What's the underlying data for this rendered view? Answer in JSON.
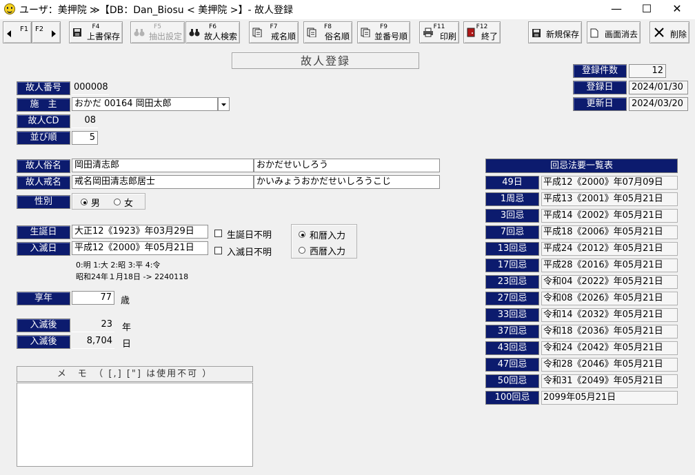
{
  "window": {
    "title": "ユーザ：美押院 ≫【DB：Dan_Biosu < 美押院 >】- 故人登録",
    "minimize": "—",
    "maximize": "☐",
    "close": "✕"
  },
  "toolbar": {
    "f1": "F1",
    "f2": "F2",
    "buttons": [
      {
        "fkey": "F4",
        "label": "上書保存",
        "icon": "floppy-disk-icon"
      },
      {
        "fkey": "F5",
        "label": "抽出設定",
        "icon": "binoculars-icon"
      },
      {
        "fkey": "F6",
        "label": "故人検索",
        "icon": "binoculars-icon"
      },
      {
        "fkey": "F7",
        "label": "戒名順",
        "icon": "document-list-icon"
      },
      {
        "fkey": "F8",
        "label": "俗名順",
        "icon": "document-list-icon"
      },
      {
        "fkey": "F9",
        "label": "並番号順",
        "icon": "document-list-icon"
      },
      {
        "fkey": "F11",
        "label": "印刷",
        "icon": "printer-icon"
      },
      {
        "fkey": "F12",
        "label": "終了",
        "icon": "exit-door-icon"
      }
    ],
    "new_save": "新規保存",
    "clear_screen": "画面消去",
    "delete": "削除"
  },
  "form": {
    "heading": "故人登録",
    "kojin_no_label": "故人番号",
    "kojin_no": "000008",
    "seshu_label": "施　主",
    "seshu": "おかだ 00164 岡田太郎",
    "kojin_cd_label": "故人CD",
    "kojin_cd": "08",
    "order_label": "並び順",
    "order": "5",
    "zokumyo_label": "故人俗名",
    "zokumyo": "岡田清志郎",
    "zokumyo_kana": "おかだせいしろう",
    "kaimyo_label": "故人戒名",
    "kaimyo": "戒名岡田清志郎居士",
    "kaimyo_kana": "かいみょうおかだせいしろうこじ",
    "gender_label": "性別",
    "gender_male": "男",
    "gender_female": "女",
    "birth_label": "生誕日",
    "birth": "大正12《1923》年03月29日",
    "birth_unknown": "生誕日不明",
    "death_label": "入滅日",
    "death": "平成12《2000》年05月21日",
    "death_unknown": "入滅日不明",
    "calendar_wareki": "和暦入力",
    "calendar_seireki": "西暦入力",
    "era_hint": "0:明 1:大 2:昭 3:平 4:令",
    "era_example": "昭和24年１月18日 -> 2240118",
    "age_label": "享年",
    "age": "77",
    "age_unit": "歳",
    "after_years_label": "入滅後",
    "after_years": "23",
    "after_years_unit": "年",
    "after_days_label": "入滅後",
    "after_days": "8,704",
    "after_days_unit": "日",
    "memo_header": "メ　モ　（ [,] [\"] は使用不可 ）"
  },
  "registry": {
    "count_label": "登録件数",
    "count": "12",
    "registered_label": "登録日",
    "registered": "2024/01/30",
    "updated_label": "更新日",
    "updated": "2024/03/20"
  },
  "memorial": {
    "header": "回忌法要一覧表",
    "rows": [
      {
        "name": "49日",
        "date": "平成12《2000》年07月09日"
      },
      {
        "name": "1周忌",
        "date": "平成13《2001》年05月21日"
      },
      {
        "name": "3回忌",
        "date": "平成14《2002》年05月21日"
      },
      {
        "name": "7回忌",
        "date": "平成18《2006》年05月21日"
      },
      {
        "name": "13回忌",
        "date": "平成24《2012》年05月21日"
      },
      {
        "name": "17回忌",
        "date": "平成28《2016》年05月21日"
      },
      {
        "name": "23回忌",
        "date": "令和04《2022》年05月21日"
      },
      {
        "name": "27回忌",
        "date": "令和08《2026》年05月21日"
      },
      {
        "name": "33回忌",
        "date": "令和14《2032》年05月21日"
      },
      {
        "name": "37回忌",
        "date": "令和18《2036》年05月21日"
      },
      {
        "name": "43回忌",
        "date": "令和24《2042》年05月21日"
      },
      {
        "name": "47回忌",
        "date": "令和28《2046》年05月21日"
      },
      {
        "name": "50回忌",
        "date": "令和31《2049》年05月21日"
      },
      {
        "name": "100回忌",
        "date": "2099年05月21日"
      }
    ]
  }
}
